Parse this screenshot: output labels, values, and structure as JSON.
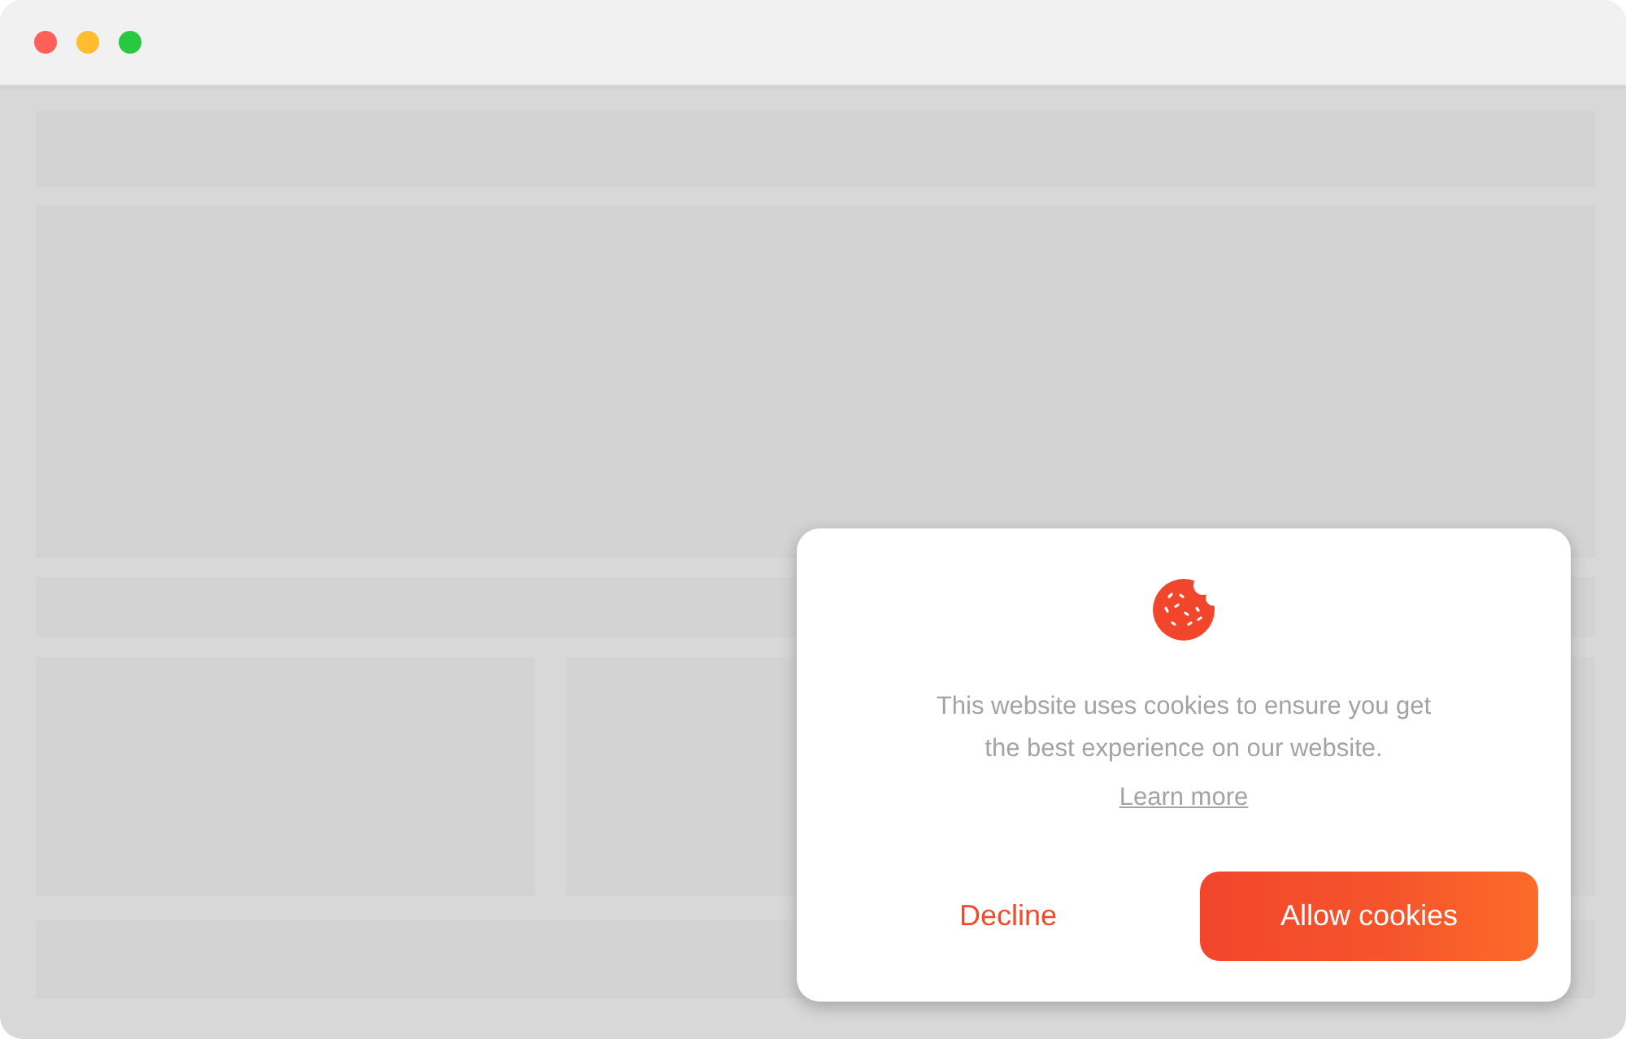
{
  "cookie_dialog": {
    "message": "This website uses cookies to ensure you get the best experience on our website.",
    "link": "Learn more",
    "buttons": [
      {
        "label": "Decline",
        "kind": "text"
      },
      {
        "label": "Allow cookies",
        "kind": "primary"
      }
    ]
  }
}
